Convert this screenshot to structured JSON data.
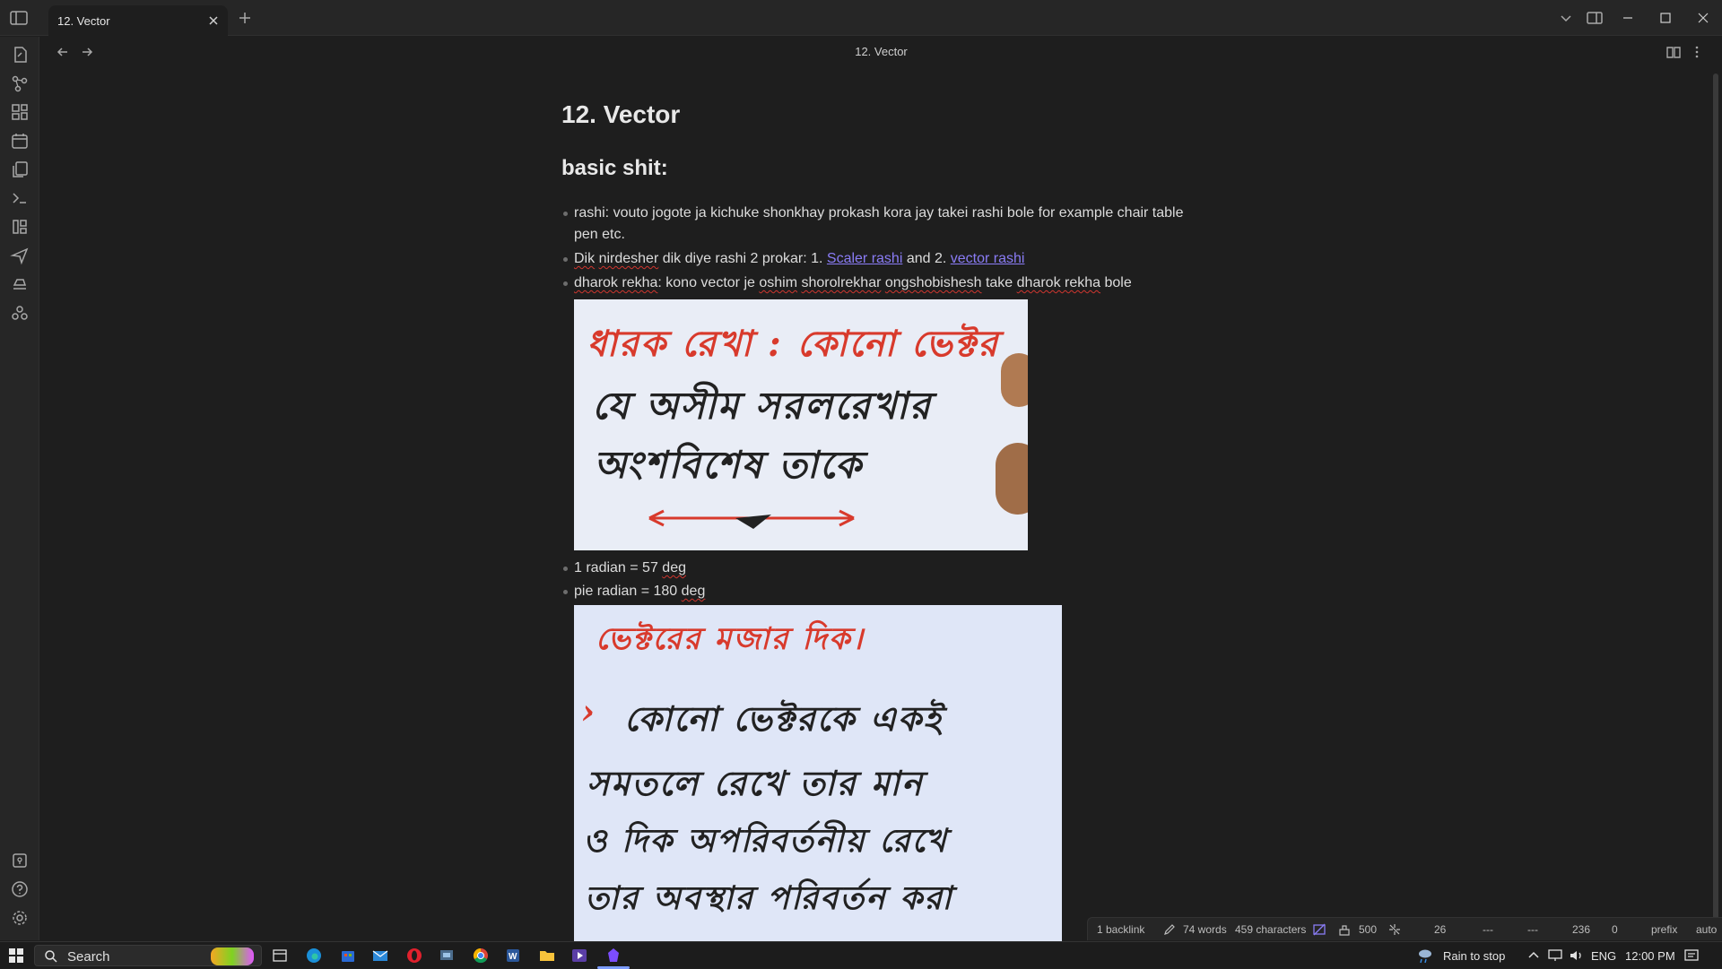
{
  "tab": {
    "title": "12. Vector"
  },
  "view": {
    "title": "12. Vector"
  },
  "document": {
    "h1": "12. Vector",
    "h2": "basic shit:",
    "bullet1": "rashi: vouto jogote ja kichuke shonkhay prokash kora jay takei rashi bole for example chair table pen etc.",
    "bullet2_prefix_a": "Dik",
    "bullet2_prefix_b": " ",
    "bullet2_prefix_c": "nirdesher",
    "bullet2_prefix_d": " dik diye rashi 2 prokar: 1. ",
    "bullet2_link1": "Scaler rashi",
    "bullet2_mid": " and 2. ",
    "bullet2_link2": "vector rashi",
    "bullet3_a": "dharok rekha",
    "bullet3_b": ": kono vector je ",
    "bullet3_c": "oshim",
    "bullet3_d": " ",
    "bullet3_e": "shorolrekhar",
    "bullet3_f": " ",
    "bullet3_g": "ongshobishesh",
    "bullet3_h": " take ",
    "bullet3_i": "dharok rekha",
    "bullet3_j": " bole",
    "bullet4_a": "1 radian = 57 ",
    "bullet4_b": "deg",
    "bullet5_a": "pie radian = 180 ",
    "bullet5_b": "deg",
    "image1_lines": [
      "ধারক রেখা : কোনো ভেক্টর",
      "যে অসীম সরলরেখার",
      "অংশবিশেষ তাকে"
    ],
    "image2_lines": [
      "ভেক্টরের মজার দিক।",
      "কোনো ভেক্টরকে একই",
      "সমতলে রেখে তার মান",
      "ও দিক অপরিবর্তনীয় রেখে",
      "তার অবস্থার পরিবর্তন করা"
    ]
  },
  "statusbar": {
    "backlinks": "1 backlink",
    "words": "74 words",
    "characters": "459 characters",
    "goal": "500",
    "s1": "26",
    "s2": "---",
    "s3": "---",
    "s4": "236",
    "s5": "0",
    "prefix": "prefix",
    "auto": "auto"
  },
  "taskbar": {
    "search_label": "Search",
    "weather": "Rain to stop",
    "lang": "ENG",
    "time": "12:00 PM"
  },
  "colors": {
    "accent": "#8a7cf5",
    "spell": "#d0362f",
    "bg": "#1e1e1e"
  }
}
